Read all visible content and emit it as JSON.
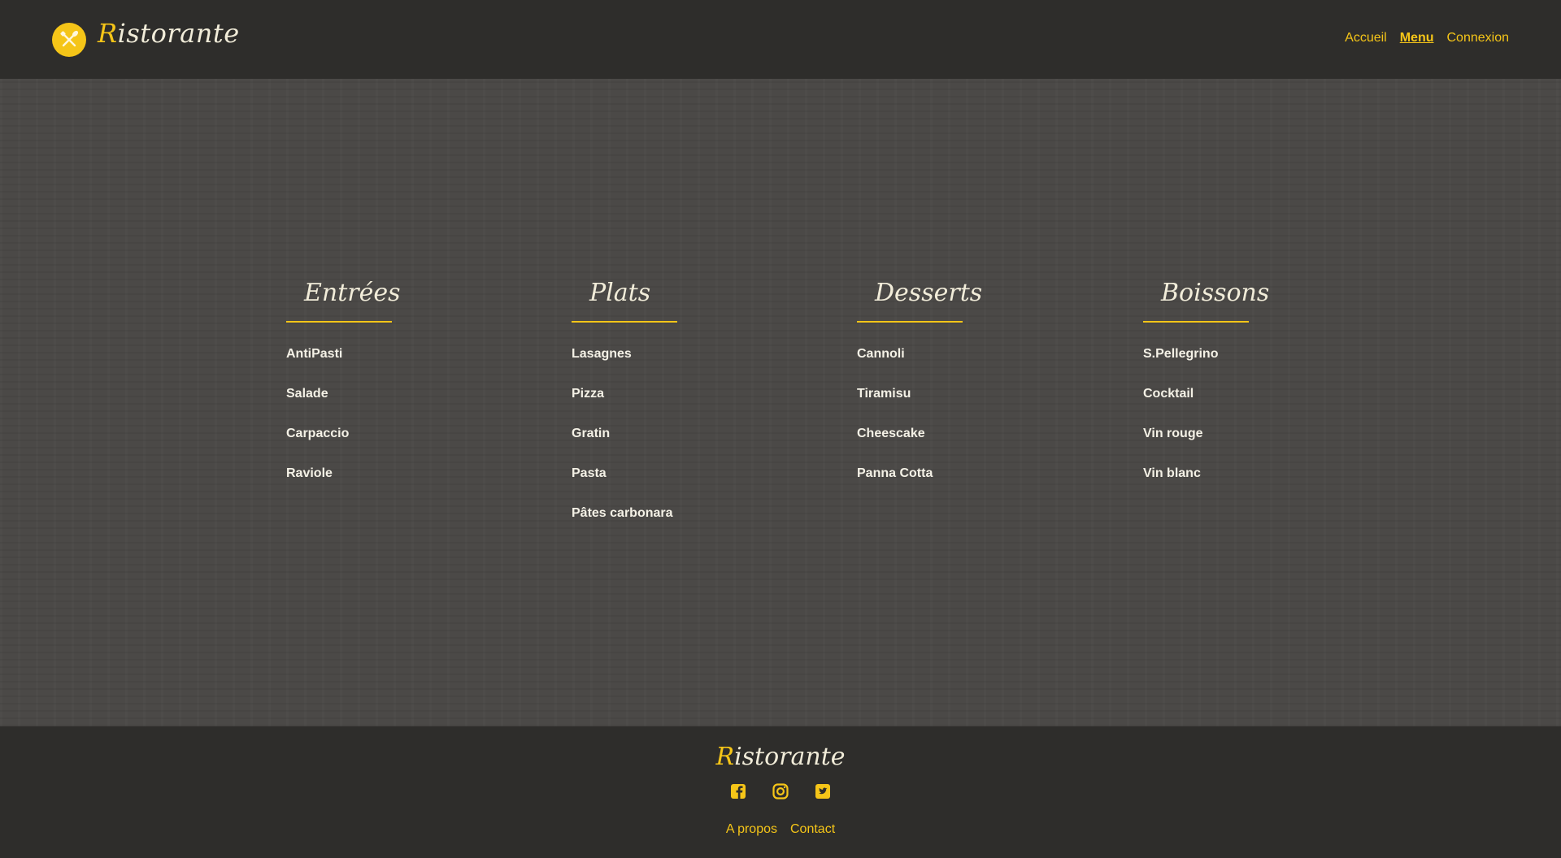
{
  "colors": {
    "accent": "#f5c518",
    "header_bg": "#2e2d2b",
    "main_bg": "#4b4947",
    "text_light": "#f4f1e6"
  },
  "header": {
    "brand_first": "R",
    "brand_rest": "istorante",
    "logo_icon": "fork-knife-icon",
    "nav": [
      "Accueil",
      "Menu",
      "Connexion"
    ],
    "active_nav": "Menu"
  },
  "menu": {
    "columns": [
      {
        "title": "Entrées",
        "items": [
          "AntiPasti",
          "Salade",
          "Carpaccio",
          "Raviole"
        ]
      },
      {
        "title": "Plats",
        "items": [
          "Lasagnes",
          "Pizza",
          "Gratin",
          "Pasta",
          "Pâtes carbonara"
        ]
      },
      {
        "title": "Desserts",
        "items": [
          "Cannoli",
          "Tiramisu",
          "Cheescake",
          "Panna Cotta"
        ]
      },
      {
        "title": "Boissons",
        "items": [
          "S.Pellegrino",
          "Cocktail",
          "Vin rouge",
          "Vin blanc"
        ]
      }
    ]
  },
  "footer": {
    "brand_first": "R",
    "brand_rest": "istorante",
    "socials": [
      "facebook-icon",
      "instagram-icon",
      "twitter-icon"
    ],
    "links": [
      "A propos",
      "Contact"
    ]
  }
}
